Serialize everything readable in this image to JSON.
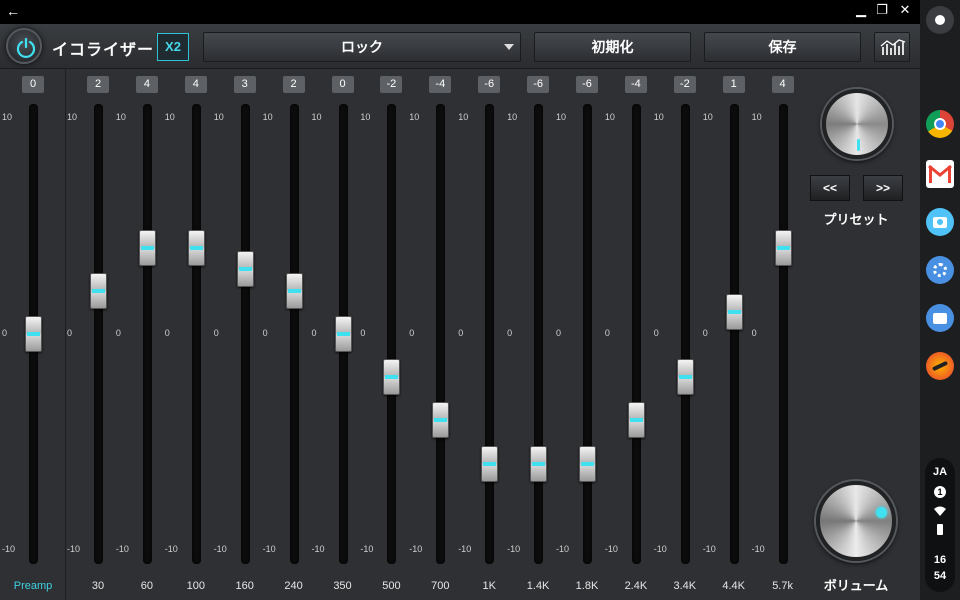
{
  "app": {
    "title": "イコライザー",
    "x2_label": "X2",
    "preset_select": "ロック",
    "reset_label": "初期化",
    "save_label": "保存",
    "accent_color": "#3fe0f0"
  },
  "preamp": {
    "label": "Preamp",
    "value": "0",
    "value_num": 0
  },
  "scale": {
    "max": "10",
    "mid": "0",
    "min": "-10"
  },
  "bands": [
    {
      "freq": "30",
      "value": "2",
      "value_num": 2
    },
    {
      "freq": "60",
      "value": "4",
      "value_num": 4
    },
    {
      "freq": "100",
      "value": "4",
      "value_num": 4
    },
    {
      "freq": "160",
      "value": "3",
      "value_num": 3
    },
    {
      "freq": "240",
      "value": "2",
      "value_num": 2
    },
    {
      "freq": "350",
      "value": "0",
      "value_num": 0
    },
    {
      "freq": "500",
      "value": "-2",
      "value_num": -2
    },
    {
      "freq": "700",
      "value": "-4",
      "value_num": -4
    },
    {
      "freq": "1K",
      "value": "-6",
      "value_num": -6
    },
    {
      "freq": "1.4K",
      "value": "-6",
      "value_num": -6
    },
    {
      "freq": "1.8K",
      "value": "-6",
      "value_num": -6
    },
    {
      "freq": "2.4K",
      "value": "-4",
      "value_num": -4
    },
    {
      "freq": "3.4K",
      "value": "-2",
      "value_num": -2
    },
    {
      "freq": "4.4K",
      "value": "1",
      "value_num": 1
    },
    {
      "freq": "5.7k",
      "value": "4",
      "value_num": 4
    }
  ],
  "right_panel": {
    "prev_label": "<<",
    "next_label": ">>",
    "preset_label": "プリセット",
    "volume_label": "ボリューム"
  },
  "shelf": {
    "apps": [
      "chrome-icon",
      "gmail-icon",
      "camera-icon",
      "settings-icon",
      "files-icon",
      "music-app-icon"
    ],
    "lang": "JA",
    "notif_count": "1",
    "time_hour": "16",
    "time_min": "54"
  }
}
